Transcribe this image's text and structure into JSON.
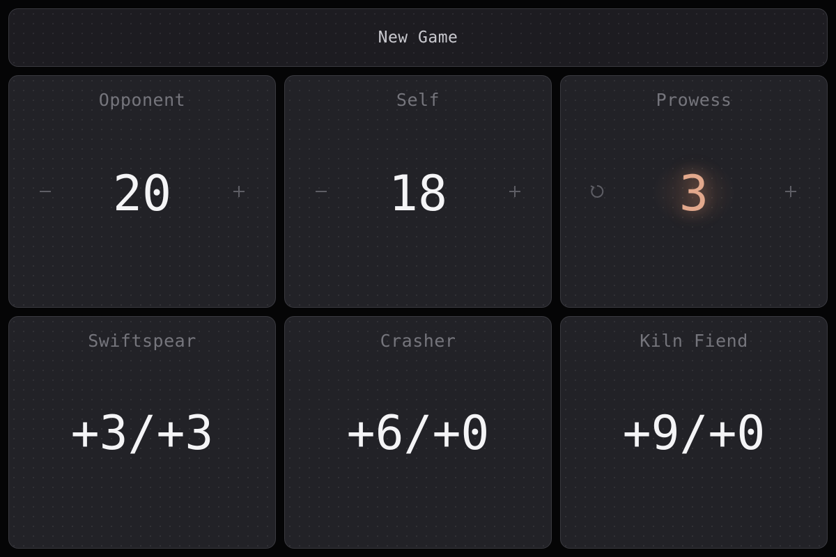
{
  "header": {
    "new_game_label": "New Game"
  },
  "counters": {
    "opponent": {
      "label": "Opponent",
      "value": "20",
      "decrement_icon": "minus-icon",
      "increment_icon": "plus-icon"
    },
    "self": {
      "label": "Self",
      "value": "18",
      "decrement_icon": "minus-icon",
      "increment_icon": "plus-icon"
    },
    "prowess": {
      "label": "Prowess",
      "value": "3",
      "reset_icon": "reset-icon",
      "increment_icon": "plus-icon",
      "accent_color": "#e2a88c"
    }
  },
  "creatures": {
    "swiftspear": {
      "label": "Swiftspear",
      "value": "+3/+3"
    },
    "crasher": {
      "label": "Crasher",
      "value": "+6/+0"
    },
    "kiln_fiend": {
      "label": "Kiln Fiend",
      "value": "+9/+0"
    }
  },
  "colors": {
    "background": "#050506",
    "panel": "#222227",
    "text": "#f4f4f6",
    "muted": "#75757c",
    "accent": "#e2a88c"
  }
}
